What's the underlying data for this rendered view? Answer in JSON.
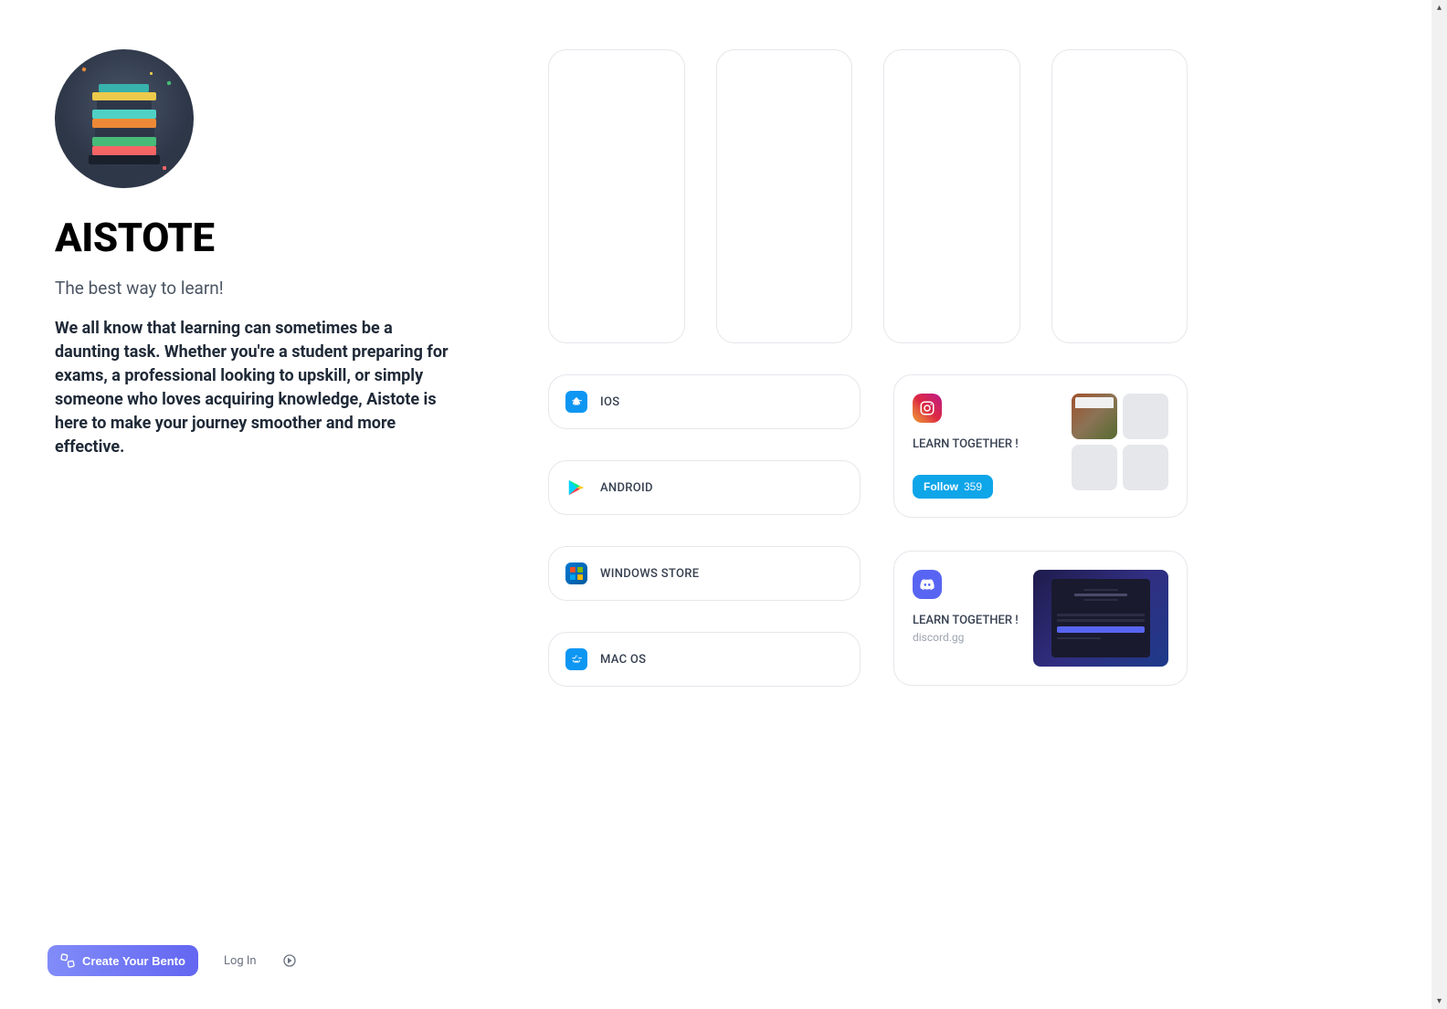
{
  "profile": {
    "title": "AISTOTE",
    "tagline": "The best way to learn!",
    "description": "We all know that learning can sometimes be a daunting task. Whether you're a student preparing for exams, a professional looking to upskill, or simply someone who loves acquiring knowledge, Aistote is here to make your journey smoother and more effective."
  },
  "platforms": [
    {
      "label": "IOS",
      "icon": "appstore"
    },
    {
      "label": "ANDROID",
      "icon": "playstore"
    },
    {
      "label": "WINDOWS STORE",
      "icon": "windows"
    },
    {
      "label": "MAC OS",
      "icon": "appstore"
    }
  ],
  "instagram": {
    "title": "LEARN TOGETHER !",
    "follow_label": "Follow",
    "follow_count": "359"
  },
  "discord": {
    "title": "LEARN TOGETHER !",
    "subtitle": "discord.gg"
  },
  "bottom_bar": {
    "create_label": "Create Your Bento",
    "login_label": "Log In"
  }
}
